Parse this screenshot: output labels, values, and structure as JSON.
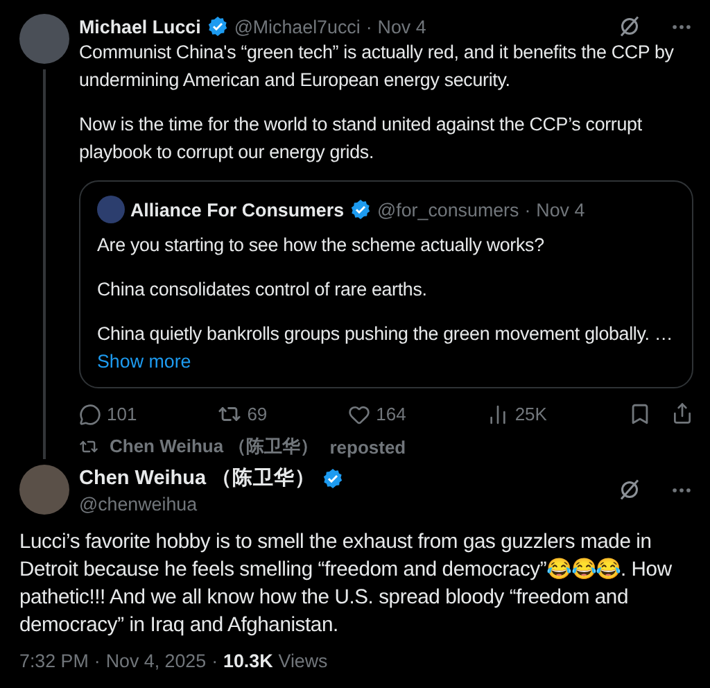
{
  "tweet": {
    "author": "Michael Lucci",
    "verified": true,
    "handle": "@Michael7ucci",
    "separator": "·",
    "date": "Nov 4",
    "paragraphs": [
      "Communist China's “green tech” is actually red, and it benefits the CCP by undermining American and European energy security.",
      "Now is the time for the world to stand united against the CCP’s corrupt playbook to corrupt our energy grids."
    ],
    "quote": {
      "author": "Alliance For Consumers",
      "verified": true,
      "handle": "@for_consumers",
      "separator": "·",
      "date": "Nov 4",
      "paragraphs": [
        "Are you starting to see how the scheme actually works?",
        "China consolidates control of rare earths.",
        "China quietly bankrolls groups pushing the green movement globally. …"
      ],
      "show_more": "Show more"
    },
    "stats": {
      "replies": "101",
      "reposts": "69",
      "likes": "164",
      "views": "25K"
    }
  },
  "repost": {
    "by": "Chen Weihua （陈卫华）",
    "label": "reposted"
  },
  "reply": {
    "author": "Chen Weihua （陈卫华）",
    "verified": true,
    "handle": "@chenweihua",
    "body": "Lucci’s favorite hobby is to smell the exhaust from gas guzzlers made in Detroit because he feels smelling “freedom and democracy”😂😂😂. How pathetic!!! And we all know how the U.S. spread bloody “freedom and democracy” in Iraq and Afghanistan.",
    "time": "7:32 PM",
    "separator": "·",
    "date": "Nov 4, 2025",
    "views_count": "10.3K",
    "views_label": "Views"
  }
}
